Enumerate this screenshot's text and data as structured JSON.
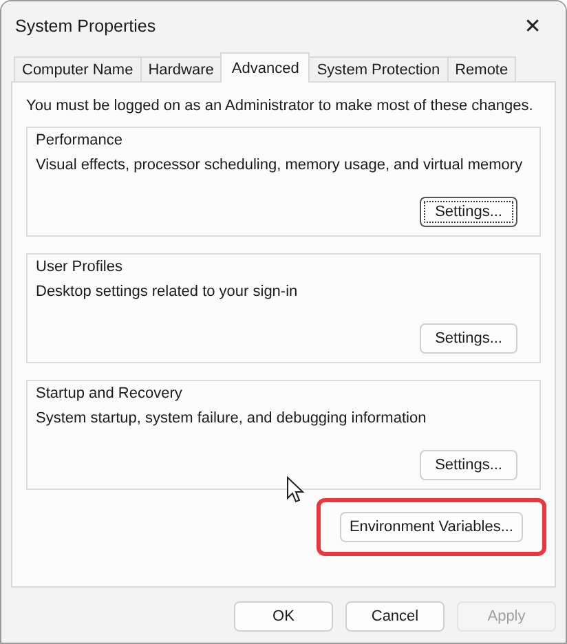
{
  "window": {
    "title": "System Properties",
    "close": "✕"
  },
  "tabs": [
    {
      "label": "Computer Name",
      "selected": false
    },
    {
      "label": "Hardware",
      "selected": false
    },
    {
      "label": "Advanced",
      "selected": true
    },
    {
      "label": "System Protection",
      "selected": false
    },
    {
      "label": "Remote",
      "selected": false
    }
  ],
  "notice": "You must be logged on as an Administrator to make most of these changes.",
  "groups": [
    {
      "title": "Performance",
      "description": "Visual effects, processor scheduling, memory usage, and virtual memory",
      "button": {
        "label": "Settings...",
        "focused": true
      }
    },
    {
      "title": "User Profiles",
      "description": "Desktop settings related to your sign-in",
      "button": {
        "label": "Settings...",
        "focused": false
      }
    },
    {
      "title": "Startup and Recovery",
      "description": "System startup, system failure, and debugging information",
      "button": {
        "label": "Settings...",
        "focused": false
      }
    }
  ],
  "environment_button": {
    "label": "Environment Variables...",
    "highlighted": true
  },
  "footer_buttons": [
    {
      "label": "OK",
      "disabled": false
    },
    {
      "label": "Cancel",
      "disabled": false
    },
    {
      "label": "Apply",
      "disabled": true
    }
  ]
}
